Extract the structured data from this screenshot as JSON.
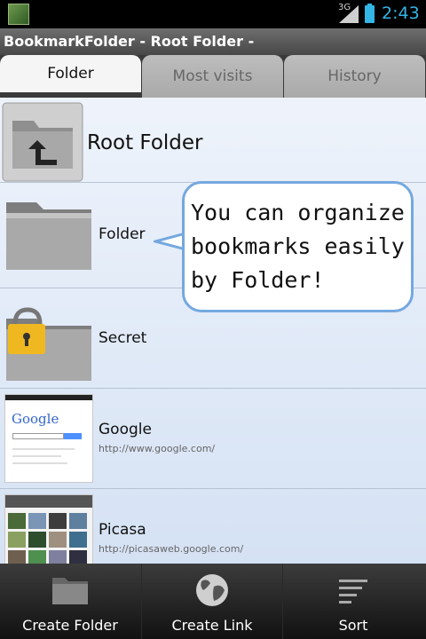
{
  "status_bar": {
    "network": "3G",
    "time": "2:43",
    "accent_color": "#33b5e5"
  },
  "app": {
    "title": "BookmarkFolder - Root Folder -"
  },
  "tabs": [
    {
      "label": "Folder",
      "selected": true
    },
    {
      "label": "Most visits",
      "selected": false
    },
    {
      "label": "History",
      "selected": false
    }
  ],
  "list": {
    "root": {
      "label": "Root Folder",
      "icon": "folder-up-icon"
    },
    "items": [
      {
        "label": "Folder",
        "icon": "folder-icon"
      },
      {
        "label": "Secret",
        "icon": "locked-folder-icon"
      },
      {
        "label": "Google",
        "url": "http://www.google.com/",
        "thumb_text": "Google"
      },
      {
        "label": "Picasa",
        "url": "http://picasaweb.google.com/"
      }
    ]
  },
  "callout": {
    "text": "You can organize\nbookmarks easily\nby Folder!"
  },
  "bottom_bar": [
    {
      "label": "Create Folder",
      "icon": "folder-icon"
    },
    {
      "label": "Create Link",
      "icon": "globe-icon"
    },
    {
      "label": "Sort",
      "icon": "sort-icon"
    }
  ]
}
